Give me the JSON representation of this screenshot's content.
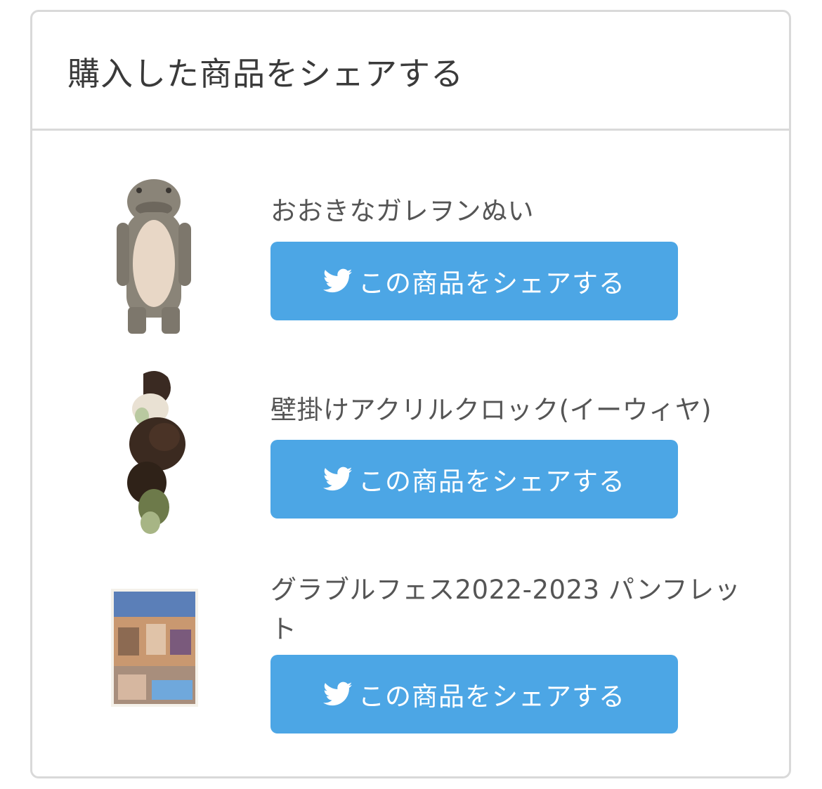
{
  "card": {
    "title": "購入した商品をシェアする"
  },
  "products": [
    {
      "name": "おおきなガレヲンぬい",
      "share_label": "この商品をシェアする",
      "icon": "twitter-bird-icon"
    },
    {
      "name": "壁掛けアクリルクロック(イーウィヤ)",
      "share_label": "この商品をシェアする",
      "icon": "twitter-bird-icon"
    },
    {
      "name": "グラブルフェス2022-2023 パンフレット",
      "share_label": "この商品をシェアする",
      "icon": "twitter-bird-icon"
    }
  ],
  "colors": {
    "button": "#4ca6e5",
    "border": "#d9d9d9",
    "title": "#3a3a3a",
    "text": "#555555"
  }
}
